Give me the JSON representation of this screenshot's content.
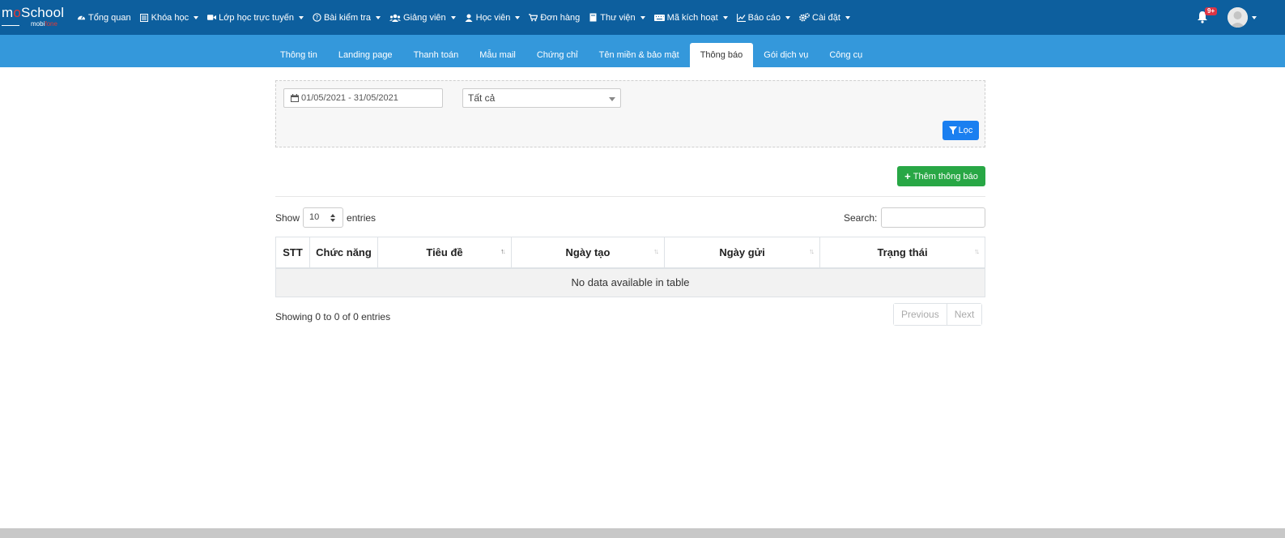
{
  "brand": {
    "logo_main_prefix": "m",
    "logo_main_o": "o",
    "logo_main_suffix": "School",
    "logo_sub_prefix": "mobi",
    "logo_sub_suffix": "fone"
  },
  "nav": [
    {
      "label": "Tổng quan",
      "icon": "dashboard-icon",
      "dropdown": false
    },
    {
      "label": "Khóa học",
      "icon": "list-icon",
      "dropdown": true
    },
    {
      "label": "Lớp học trực tuyến",
      "icon": "video-icon",
      "dropdown": true
    },
    {
      "label": "Bài kiểm tra",
      "icon": "question-icon",
      "dropdown": true
    },
    {
      "label": "Giảng viên",
      "icon": "users-icon",
      "dropdown": true
    },
    {
      "label": "Học viên",
      "icon": "user-icon",
      "dropdown": true
    },
    {
      "label": "Đơn hàng",
      "icon": "cart-icon",
      "dropdown": false
    },
    {
      "label": "Thư viện",
      "icon": "book-icon",
      "dropdown": true
    },
    {
      "label": "Mã kích hoạt",
      "icon": "keyboard-icon",
      "dropdown": true
    },
    {
      "label": "Báo cáo",
      "icon": "chart-icon",
      "dropdown": true
    },
    {
      "label": "Cài đặt",
      "icon": "cogs-icon",
      "dropdown": true
    }
  ],
  "notifications": {
    "badge": "9+"
  },
  "tabs": [
    {
      "label": "Thông tin",
      "active": false
    },
    {
      "label": "Landing page",
      "active": false
    },
    {
      "label": "Thanh toán",
      "active": false
    },
    {
      "label": "Mẫu mail",
      "active": false
    },
    {
      "label": "Chứng chỉ",
      "active": false
    },
    {
      "label": "Tên miền & bảo mật",
      "active": false
    },
    {
      "label": "Thông báo",
      "active": true
    },
    {
      "label": "Gói dịch vụ",
      "active": false
    },
    {
      "label": "Công cụ",
      "active": false
    }
  ],
  "filter": {
    "date_range": "01/05/2021 - 31/05/2021",
    "status_value": "Tất cả",
    "filter_label": "Lọc"
  },
  "add_button_label": "Thêm thông báo",
  "datatable": {
    "show_label": "Show",
    "length_value": "10",
    "entries_label": "entries",
    "search_label": "Search:",
    "columns": [
      "STT",
      "Chức năng",
      "Tiêu đề",
      "Ngày tạo",
      "Ngày gửi",
      "Trạng thái"
    ],
    "empty_message": "No data available in table",
    "info": "Showing 0 to 0 of 0 entries",
    "previous_label": "Previous",
    "next_label": "Next"
  },
  "colors": {
    "topbar": "#0d5f9e",
    "subbar": "#3498db",
    "filter_button": "#1a7ff0",
    "add_button": "#28a745",
    "badge": "#dc3545"
  }
}
